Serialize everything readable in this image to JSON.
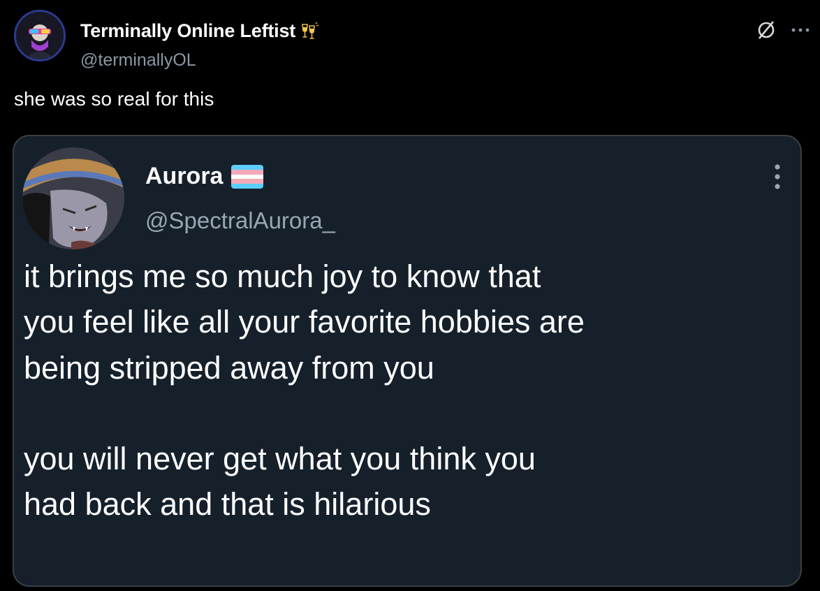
{
  "post": {
    "author": {
      "display_name": "Terminally Online Leftist",
      "handle": "@terminallyOL",
      "name_emoji": "clinking-glasses-icon"
    },
    "text": "she was so real for this",
    "actions": {
      "grok_icon": "slashed-circle-icon",
      "more_icon": "more-horizontal-icon"
    }
  },
  "quoted_post": {
    "author": {
      "display_name": "Aurora",
      "handle": "@SpectralAurora_",
      "flag": "trans-flag-icon"
    },
    "more_icon": "more-vertical-icon",
    "body": "it brings me so much joy to know that\nyou feel like all your favorite hobbies are\nbeing stripped away from you\n\nyou will never get what you think you\nhad back and that is hilarious"
  },
  "colors": {
    "background": "#000000",
    "card_background": "#15202b",
    "secondary_text": "#8b98a5",
    "trans_blue": "#5bcefa",
    "trans_pink": "#f5a9b8"
  }
}
